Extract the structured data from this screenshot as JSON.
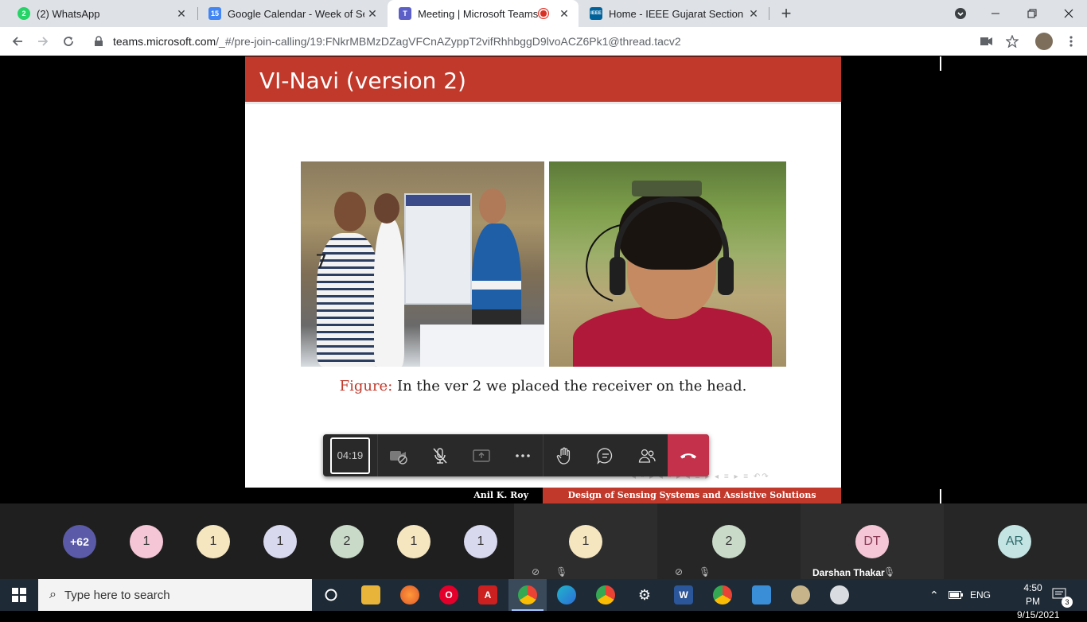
{
  "browser": {
    "tabs": [
      {
        "title": "(2) WhatsApp",
        "icon": "whatsapp-icon",
        "color": "#25d366"
      },
      {
        "title": "Google Calendar - Week of Septe",
        "icon": "google-calendar-icon",
        "color": "#4285f4",
        "badge": "15"
      },
      {
        "title": "Meeting | Microsoft Teams",
        "icon": "teams-icon",
        "color": "#5b5fc7"
      },
      {
        "title": "Home - IEEE Gujarat Section",
        "icon": "ieee-icon",
        "color": "#00629b",
        "badge": "IEEE"
      }
    ],
    "url_host": "teams.microsoft.com",
    "url_path": "/_#/pre-join-calling/19:FNkrMBMzDZagVFCnAZyppT2vifRhhbggD9lvoACZ6Pk1@thread.tacv2"
  },
  "slide": {
    "title": "VI-Navi (version 2)",
    "caption_label": "Figure:",
    "caption_text": " In the ver 2 we placed the receiver on the head.",
    "poster_number": "7",
    "footer_left": "Anil K. Roy",
    "footer_right": "Design of Sensing Systems and Assistive Solutions"
  },
  "call_controls": {
    "timer": "04:19"
  },
  "participants": {
    "overflow_count": "+62",
    "avatars": [
      {
        "label": "1",
        "color": "#f4c6d6"
      },
      {
        "label": "1",
        "color": "#f6e6c0"
      },
      {
        "label": "1",
        "color": "#d8d8ee"
      },
      {
        "label": "2",
        "color": "#c9dac8"
      },
      {
        "label": "1",
        "color": "#f6e6c0"
      },
      {
        "label": "1",
        "color": "#d8d8ee"
      }
    ],
    "tiles": [
      {
        "label": "1",
        "color": "#f6e6c0"
      },
      {
        "label": "2",
        "color": "#c9dac8"
      },
      {
        "label": "DT",
        "color": "#f4c6d6",
        "name": "Darshan Thakar"
      },
      {
        "label": "AR",
        "color": "#c4e3e3"
      }
    ]
  },
  "taskbar": {
    "search_placeholder": "Type here to search",
    "language": "ENG",
    "time": "4:50 PM",
    "date": "9/15/2021",
    "notification_count": "3"
  }
}
